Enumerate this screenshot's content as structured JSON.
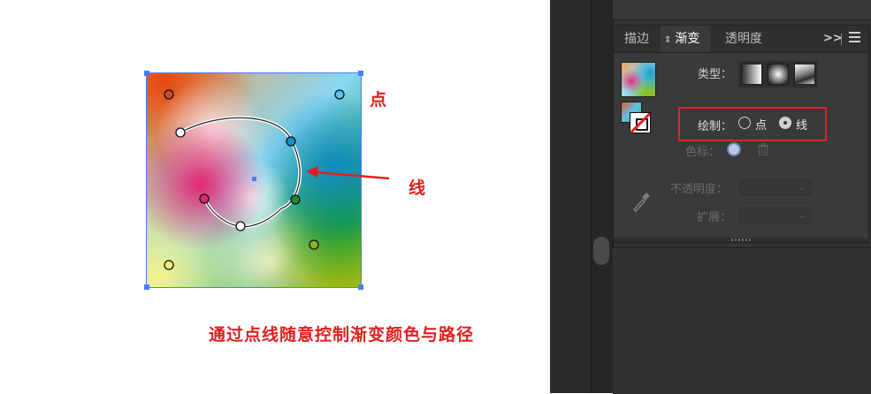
{
  "annotations": {
    "point_label": "点",
    "line_label": "线",
    "caption": "通过点线随意控制渐变颜色与路径"
  },
  "panel": {
    "tabs": [
      {
        "label": "描边",
        "active": false
      },
      {
        "label": "渐变",
        "active": true
      },
      {
        "label": "透明度",
        "active": false
      }
    ],
    "type_label": "类型：",
    "types": [
      "linear",
      "radial",
      "freeform"
    ],
    "draw_label": "绘制：",
    "draw_options": [
      {
        "label": "点",
        "selected": false
      },
      {
        "label": "线",
        "selected": true
      }
    ],
    "color_stop_label": "色标：",
    "opacity_label": "不透明度：",
    "expand_label": "扩展："
  },
  "icons": [
    "sort-icon",
    "more-panels-icon",
    "panel-menu-icon",
    "trash-icon",
    "eyedropper-icon",
    "chevron-down-icon"
  ],
  "colors": {
    "accent_red": "#e02020",
    "selection_blue": "#4a7cff",
    "panel_bg": "#3a3a3a"
  }
}
